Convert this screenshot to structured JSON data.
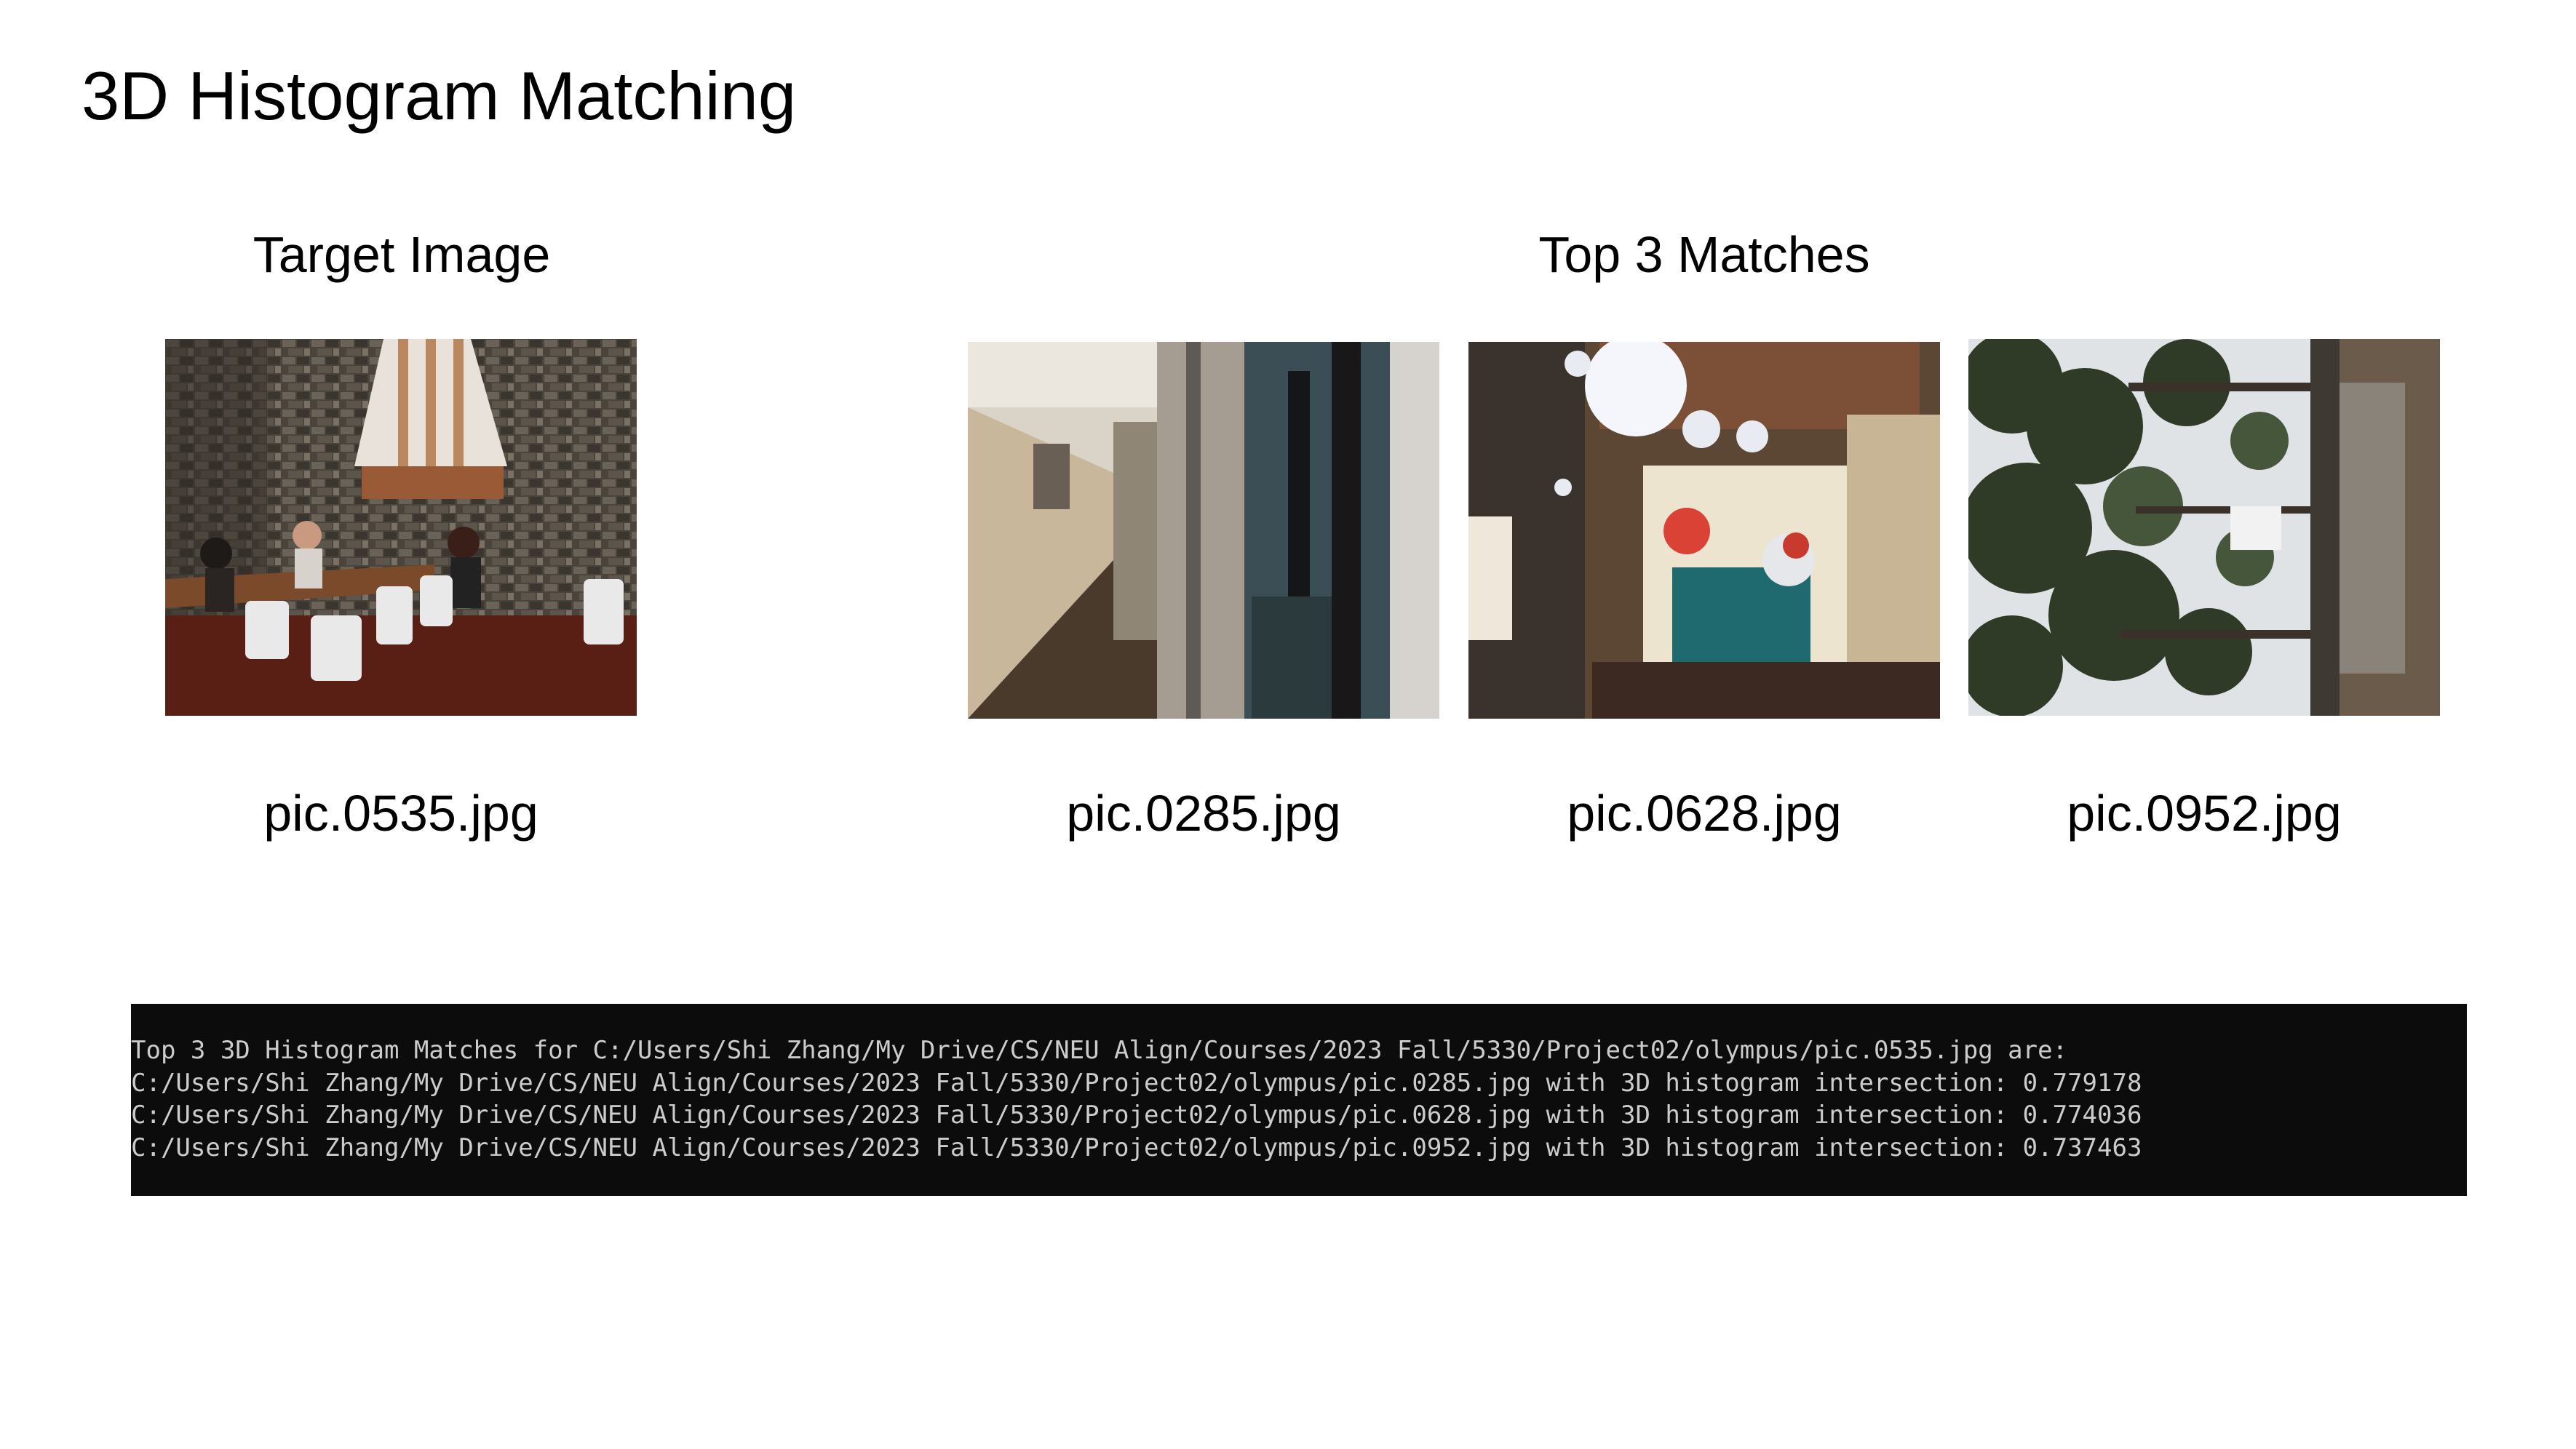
{
  "slide": {
    "title": "3D Histogram Matching"
  },
  "target": {
    "heading": "Target Image",
    "filename": "pic.0535.jpg",
    "image_icon": "photo-cafeteria-icon"
  },
  "matches": {
    "heading": "Top 3 Matches",
    "items": [
      {
        "filename": "pic.0285.jpg",
        "image_icon": "photo-hallway-icon"
      },
      {
        "filename": "pic.0628.jpg",
        "image_icon": "photo-atrium-decorations-icon"
      },
      {
        "filename": "pic.0952.jpg",
        "image_icon": "photo-trees-rotated-icon"
      }
    ]
  },
  "terminal": {
    "background": "#0c0c0c",
    "text_color": "#cccccc",
    "lines": [
      "Top 3 3D Histogram Matches for C:/Users/Shi Zhang/My Drive/CS/NEU Align/Courses/2023 Fall/5330/Project02/olympus/pic.0535.jpg are:",
      "C:/Users/Shi Zhang/My Drive/CS/NEU Align/Courses/2023 Fall/5330/Project02/olympus/pic.0285.jpg with 3D histogram intersection: 0.779178",
      "C:/Users/Shi Zhang/My Drive/CS/NEU Align/Courses/2023 Fall/5330/Project02/olympus/pic.0628.jpg with 3D histogram intersection: 0.774036",
      "C:/Users/Shi Zhang/My Drive/CS/NEU Align/Courses/2023 Fall/5330/Project02/olympus/pic.0952.jpg with 3D histogram intersection: 0.737463"
    ]
  }
}
